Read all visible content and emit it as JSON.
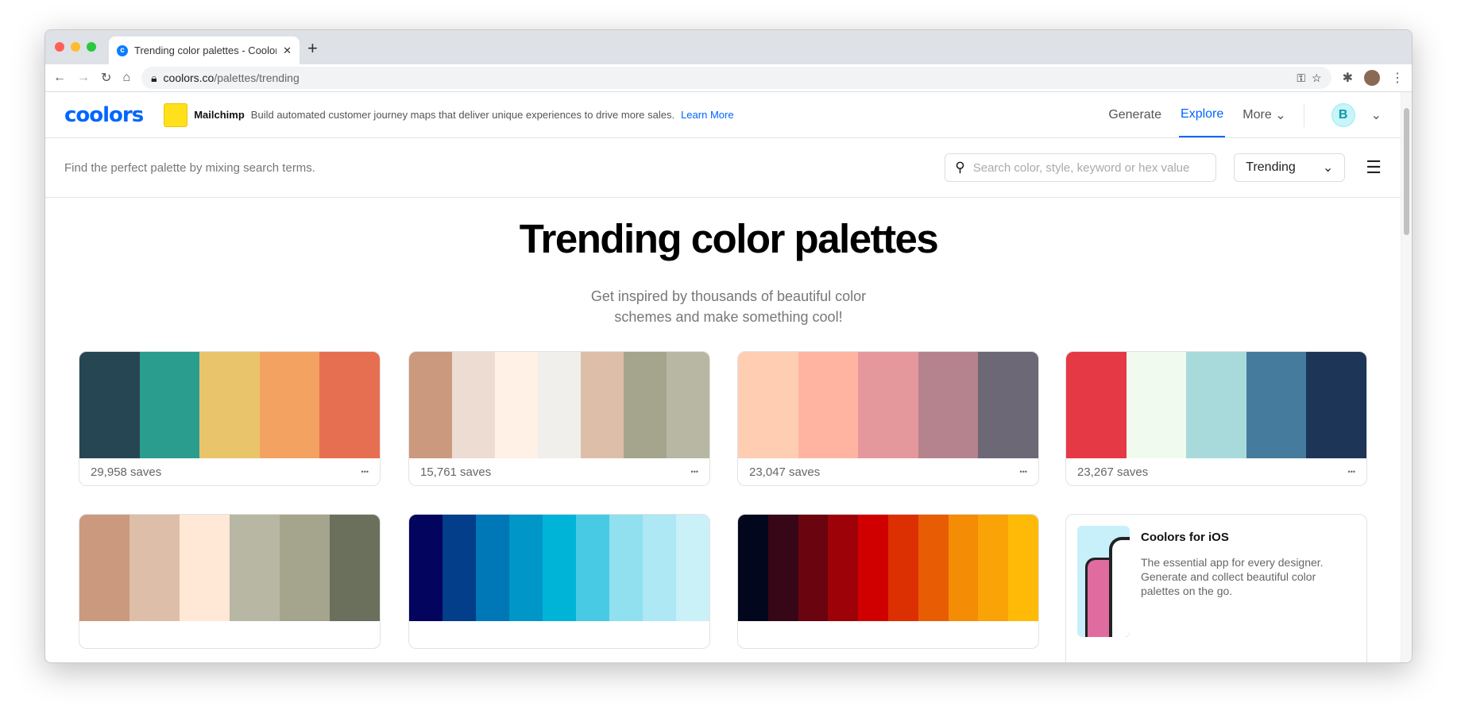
{
  "browser": {
    "tab_title": "Trending color palettes - Coolors",
    "url_host": "coolors.co",
    "url_path": "/palettes/trending"
  },
  "header": {
    "logo": "coolors",
    "ad": {
      "brand": "Mailchimp",
      "text": "Build automated customer journey maps that deliver unique experiences to drive more sales.",
      "link": "Learn More"
    },
    "nav": [
      "Generate",
      "Explore",
      "More"
    ],
    "avatar": "B",
    "accent": "#0066ff"
  },
  "search": {
    "hint": "Find the perfect palette by mixing search terms.",
    "placeholder": "Search color, style, keyword or hex value",
    "sort": "Trending"
  },
  "main": {
    "title": "Trending color palettes",
    "subtitle": "Get inspired by thousands of beautiful color schemes and make something cool!"
  },
  "palettes": [
    {
      "colors": [
        "#264653",
        "#2a9d8f",
        "#e9c46a",
        "#f4a261",
        "#e76f51"
      ],
      "saves": "29,958 saves"
    },
    {
      "colors": [
        "#cb997e",
        "#eddcd2",
        "#fff1e6",
        "#f0efeb",
        "#ddbea9",
        "#a5a58d",
        "#b7b7a4"
      ],
      "saves": "15,761 saves"
    },
    {
      "colors": [
        "#ffcdb2",
        "#ffb4a2",
        "#e5989b",
        "#b5838d",
        "#6d6875"
      ],
      "saves": "23,047 saves"
    },
    {
      "colors": [
        "#e63946",
        "#f1faee",
        "#a8dadc",
        "#457b9d",
        "#1d3557"
      ],
      "saves": "23,267 saves"
    },
    {
      "colors": [
        "#cb997e",
        "#ddbea9",
        "#ffe8d6",
        "#b7b7a4",
        "#a5a58d",
        "#6b705c"
      ]
    },
    {
      "colors": [
        "#03045e",
        "#023e8a",
        "#0077b6",
        "#0096c7",
        "#00b4d8",
        "#48cae4",
        "#90e0ef",
        "#ade8f4",
        "#caf0f8"
      ]
    },
    {
      "colors": [
        "#03071e",
        "#370617",
        "#6a040f",
        "#9d0208",
        "#d00000",
        "#dc2f02",
        "#e85d04",
        "#f48c06",
        "#faa307",
        "#ffba08"
      ]
    }
  ],
  "promo": {
    "title": "Coolors for iOS",
    "description": "The essential app for every designer. Generate and collect beautiful color palettes on the go."
  }
}
